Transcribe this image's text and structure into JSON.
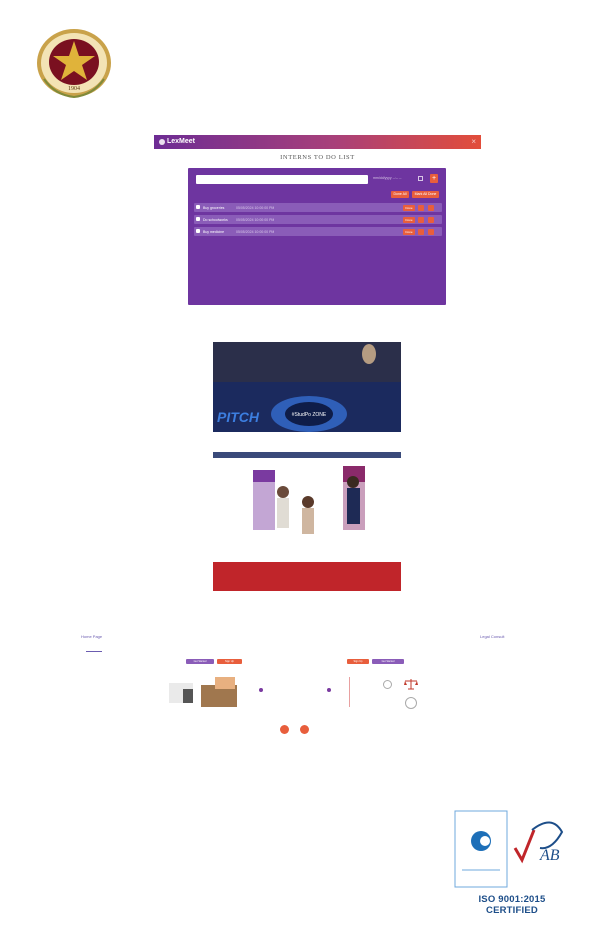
{
  "seal": {
    "year": "1904",
    "ring_text": "PHILIPPINE UNIVERSITY OF THE PHILIPPINES"
  },
  "lexmeet": {
    "app_name": "LexMeet",
    "close_glyph": "×",
    "page_title": "INTERNS TO DO LIST",
    "date_label": "mm/dd/yyyy --:-- --",
    "add_label": "+",
    "done_all_label": "Done All",
    "mark_all_label": "Mark All Done",
    "tasks": [
      {
        "name": "Buy groceries",
        "date": "05/05/2024 10:00:00 PM",
        "done": "Done"
      },
      {
        "name": "Do schoolworks",
        "date": "05/05/2024 10:00:00 PM",
        "done": "Done"
      },
      {
        "name": "Buy medicine",
        "date": "05/05/2024 10:00:00 PM",
        "done": "Done"
      }
    ]
  },
  "event_photo": {
    "banner_left": "PITCH",
    "banner_center": "#StudPo ZONE"
  },
  "mobile": {
    "left_heading": "Home Page",
    "right_heading": "Legal Consult",
    "left_btn_1": "Get Started",
    "left_btn_2": "Sign Up",
    "right_btn_1": "Sign Up",
    "right_btn_2": "Get Started"
  },
  "iso": {
    "certified_text": "ISO 9001:2015 CERTIFIED",
    "ab_text": "AB"
  },
  "colors": {
    "purple": "#6e35a0",
    "orange": "#e85e3c",
    "maroon": "#7a1020",
    "gold": "#e0b33a",
    "iso_blue": "#1d4e89"
  }
}
